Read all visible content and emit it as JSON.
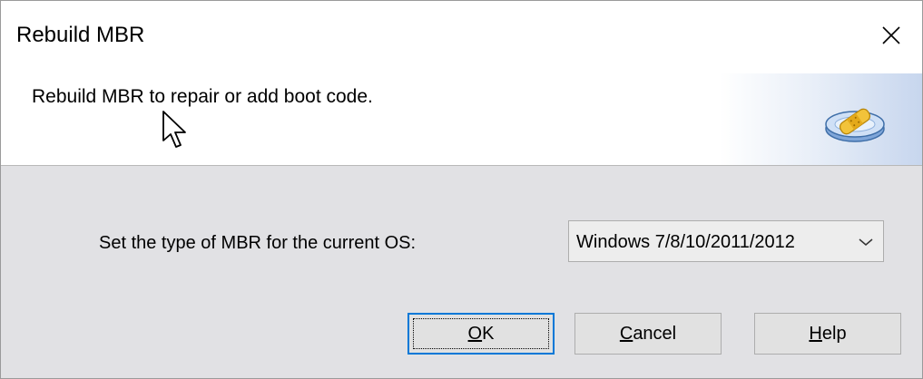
{
  "dialog": {
    "title": "Rebuild MBR",
    "header_text": "Rebuild MBR to repair or add boot code.",
    "mbr_type_label": "Set the type of MBR for the current OS:",
    "mbr_type_selected": "Windows 7/8/10/2011/2012",
    "buttons": {
      "ok_mnemonic": "O",
      "ok_rest": "K",
      "cancel_mnemonic": "C",
      "cancel_rest": "ancel",
      "help_mnemonic": "H",
      "help_rest": "elp"
    }
  },
  "icons": {
    "close": "close-icon",
    "header": "disk-repair-icon",
    "dropdown": "chevron-down-icon",
    "cursor": "mouse-pointer-icon"
  },
  "colors": {
    "focus_border": "#0078d7",
    "content_bg": "#e1e1e4",
    "header_gradient_end": "#c7d6ee"
  }
}
